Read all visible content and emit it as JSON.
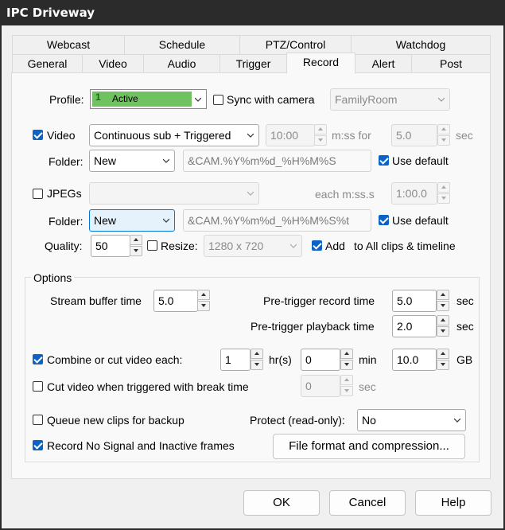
{
  "window": {
    "title": "IPC Driveway"
  },
  "tabs": {
    "row1": [
      "Webcast",
      "Schedule",
      "PTZ/Control",
      "Watchdog"
    ],
    "row2": [
      "General",
      "Video",
      "Audio",
      "Trigger",
      "Record",
      "Alert",
      "Post"
    ],
    "selected": "Record"
  },
  "profile": {
    "label": "Profile:",
    "number": "1",
    "value": "Active",
    "sync_label": "Sync with camera",
    "sync_camera": "FamilyRoom"
  },
  "video": {
    "label": "Video",
    "mode": "Continuous sub + Triggered",
    "time": "10:00",
    "time_suffix": "m:ss for",
    "seconds": "5.0",
    "seconds_unit": "sec",
    "folder_label": "Folder:",
    "folder": "New",
    "pattern": "&CAM.%Y%m%d_%H%M%S",
    "use_default": "Use default"
  },
  "jpegs": {
    "label": "JPEGs",
    "mode": "",
    "each_label": "each m:ss.s",
    "interval": "1:00.0",
    "folder_label": "Folder:",
    "folder": "New",
    "pattern": "&CAM.%Y%m%d_%H%M%S%t",
    "use_default": "Use default"
  },
  "quality": {
    "label": "Quality:",
    "value": "50",
    "resize_label": "Resize:",
    "resize_value": "1280 x 720",
    "add_label": "Add",
    "add_target": "to All clips & timeline"
  },
  "options": {
    "legend": "Options",
    "stream_buffer_label": "Stream buffer time",
    "stream_buffer": "5.0",
    "pre_trigger_record_label": "Pre-trigger record time",
    "pre_trigger_record": "5.0",
    "pre_trigger_playback_label": "Pre-trigger playback time",
    "pre_trigger_playback": "2.0",
    "sec": "sec",
    "combine_label": "Combine or cut video each:",
    "combine_hours": "1",
    "hours_unit": "hr(s)",
    "combine_min": "0",
    "min_unit": "min",
    "combine_gb": "10.0",
    "gb_unit": "GB",
    "cut_label": "Cut video when triggered with break time",
    "cut_value": "0",
    "cut_unit": "sec",
    "queue_label": "Queue new clips for backup",
    "protect_label": "Protect (read-only):",
    "protect_value": "No",
    "no_signal_label": "Record No Signal and Inactive frames",
    "file_format_button": "File format and compression..."
  },
  "buttons": {
    "ok": "OK",
    "cancel": "Cancel",
    "help": "Help"
  },
  "colors": {
    "active_profile": "#70c160",
    "checkbox": "#0a64c8",
    "titlebar": "#2b2b2b"
  }
}
